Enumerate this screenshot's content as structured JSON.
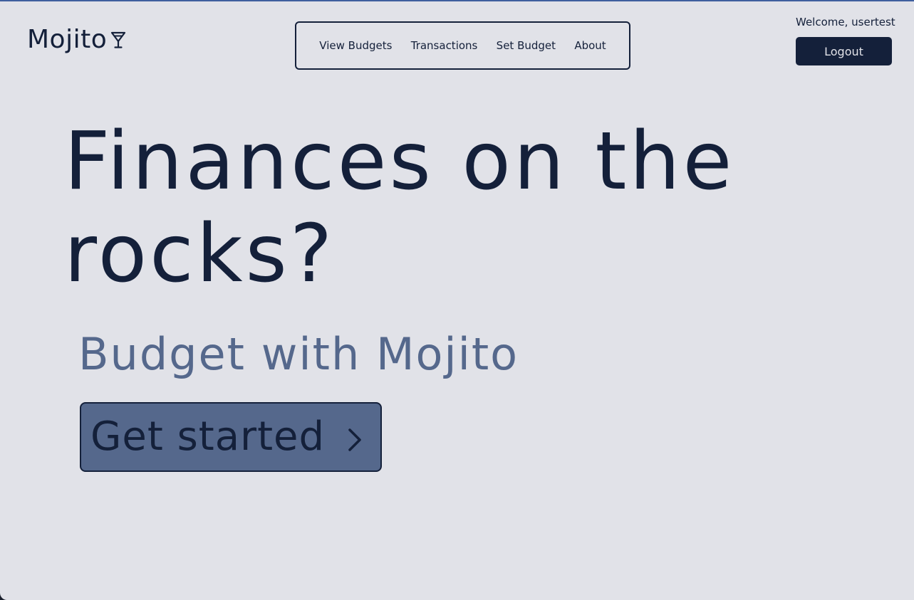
{
  "header": {
    "logo_text": "Mojito",
    "logo_icon": "cocktail-glass-icon",
    "nav": [
      {
        "label": "View Budgets"
      },
      {
        "label": "Transactions"
      },
      {
        "label": "Set Budget"
      },
      {
        "label": "About"
      }
    ],
    "welcome_text": "Welcome, usertest",
    "logout_label": "Logout"
  },
  "hero": {
    "title": "Finances on the rocks?",
    "subtitle": "Budget with Mojito",
    "cta_label": "Get started",
    "cta_icon": "chevron-right-icon"
  },
  "colors": {
    "background": "#e1e2e8",
    "primary_dark": "#14203a",
    "accent_slate": "#55688c",
    "top_border": "#3f5f9e"
  }
}
